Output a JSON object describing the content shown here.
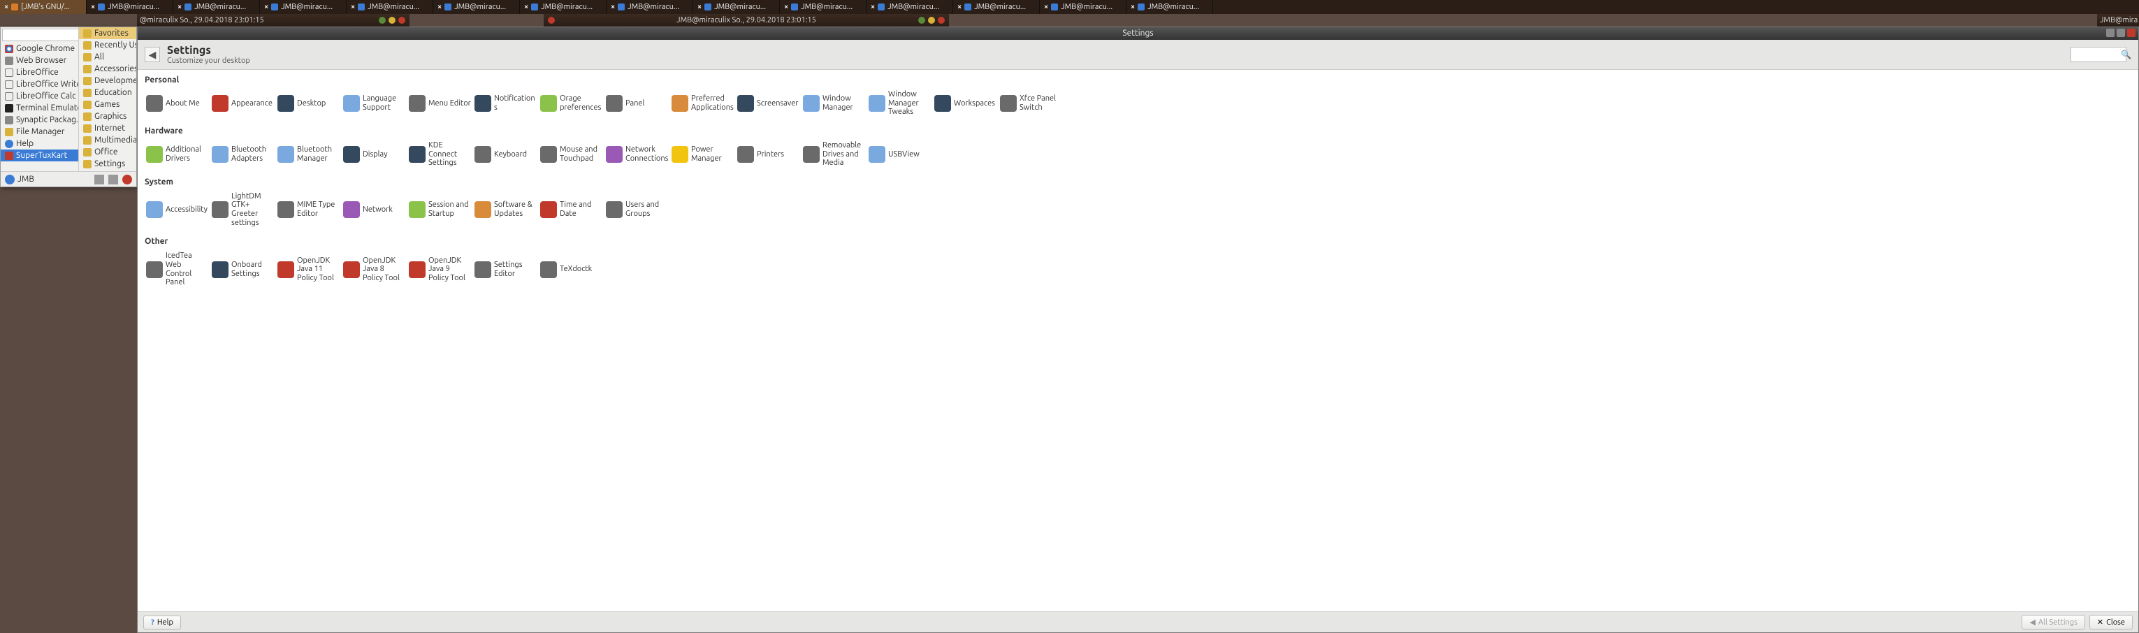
{
  "taskbar": {
    "tasks": [
      {
        "label": "[JMB's GNU/..."
      },
      {
        "label": "JMB@miracu..."
      },
      {
        "label": "JMB@miracu..."
      },
      {
        "label": "JMB@miracu..."
      },
      {
        "label": "JMB@miracu..."
      },
      {
        "label": "JMB@miracu..."
      },
      {
        "label": "JMB@miracu..."
      },
      {
        "label": "JMB@miracu..."
      },
      {
        "label": "JMB@miracu..."
      },
      {
        "label": "JMB@miracu..."
      },
      {
        "label": "JMB@miracu..."
      },
      {
        "label": "JMB@miracu..."
      },
      {
        "label": "JMB@miracu..."
      },
      {
        "label": "JMB@miracu..."
      }
    ]
  },
  "titlebars": {
    "left": "@miraculix  So., 29.04.2018 23:01:15",
    "mid": "JMB@miraculix  So., 29.04.2018 23:01:15",
    "right": "JMB@mira"
  },
  "launcher": {
    "search_placeholder": "",
    "left_items": [
      {
        "label": "Google Chrome",
        "ico": "chrome"
      },
      {
        "label": "Web Browser",
        "ico": "b"
      },
      {
        "label": "LibreOffice",
        "ico": "lib"
      },
      {
        "label": "LibreOffice Writer",
        "ico": "lib"
      },
      {
        "label": "LibreOffice Calc",
        "ico": "lib"
      },
      {
        "label": "Terminal Emulator",
        "ico": "term"
      },
      {
        "label": "Synaptic Packag...",
        "ico": "o"
      },
      {
        "label": "File Manager",
        "ico": "folder"
      },
      {
        "label": "Help",
        "ico": "help"
      },
      {
        "label": "SuperTuxKart",
        "ico": "stk",
        "sel": true
      }
    ],
    "right_items": [
      {
        "label": "Favorites",
        "fav": true
      },
      {
        "label": "Recently Use"
      },
      {
        "label": "All"
      },
      {
        "label": "Accessories"
      },
      {
        "label": "Developmen"
      },
      {
        "label": "Education"
      },
      {
        "label": "Games"
      },
      {
        "label": "Graphics"
      },
      {
        "label": "Internet"
      },
      {
        "label": "Multimedia"
      },
      {
        "label": "Office"
      },
      {
        "label": "Settings"
      }
    ],
    "footer_user": "JMB"
  },
  "settings": {
    "window_title": "Settings",
    "title": "Settings",
    "subtitle": "Customize your desktop",
    "search_placeholder": "",
    "sections": {
      "personal": {
        "h": "Personal",
        "items": [
          {
            "label": "About Me",
            "c": "c3"
          },
          {
            "label": "Appearance",
            "c": "c5"
          },
          {
            "label": "Desktop",
            "c": "c8"
          },
          {
            "label": "Language Support",
            "c": "c1"
          },
          {
            "label": "Menu Editor",
            "c": "c3"
          },
          {
            "label": "Notifications",
            "c": "c8"
          },
          {
            "label": "Orage preferences",
            "c": "c4"
          },
          {
            "label": "Panel",
            "c": "c3"
          },
          {
            "label": "Preferred Applications",
            "c": "c2"
          },
          {
            "label": "Screensaver",
            "c": "c8"
          },
          {
            "label": "Window Manager",
            "c": "c1"
          },
          {
            "label": "Window Manager Tweaks",
            "c": "c1"
          },
          {
            "label": "Workspaces",
            "c": "c8"
          },
          {
            "label": "Xfce Panel Switch",
            "c": "c3"
          }
        ]
      },
      "hardware": {
        "h": "Hardware",
        "items": [
          {
            "label": "Additional Drivers",
            "c": "c4"
          },
          {
            "label": "Bluetooth Adapters",
            "c": "c1"
          },
          {
            "label": "Bluetooth Manager",
            "c": "c1"
          },
          {
            "label": "Display",
            "c": "c8"
          },
          {
            "label": "KDE Connect Settings",
            "c": "c8"
          },
          {
            "label": "Keyboard",
            "c": "c3"
          },
          {
            "label": "Mouse and Touchpad",
            "c": "c3"
          },
          {
            "label": "Network Connections",
            "c": "c6"
          },
          {
            "label": "Power Manager",
            "c": "c7"
          },
          {
            "label": "Printers",
            "c": "c3"
          },
          {
            "label": "Removable Drives and Media",
            "c": "c3"
          },
          {
            "label": "USBView",
            "c": "c1"
          }
        ]
      },
      "system": {
        "h": "System",
        "items": [
          {
            "label": "Accessibility",
            "c": "c1"
          },
          {
            "label": "LightDM GTK+ Greeter settings",
            "c": "c3"
          },
          {
            "label": "MIME Type Editor",
            "c": "c3"
          },
          {
            "label": "Network",
            "c": "c6"
          },
          {
            "label": "Session and Startup",
            "c": "c4"
          },
          {
            "label": "Software & Updates",
            "c": "c2"
          },
          {
            "label": "Time and Date",
            "c": "c5"
          },
          {
            "label": "Users and Groups",
            "c": "c3"
          }
        ]
      },
      "other": {
        "h": "Other",
        "items": [
          {
            "label": "IcedTea Web Control Panel",
            "c": "c3"
          },
          {
            "label": "Onboard Settings",
            "c": "c8"
          },
          {
            "label": "OpenJDK Java 11 Policy Tool",
            "c": "c5"
          },
          {
            "label": "OpenJDK Java 8 Policy Tool",
            "c": "c5"
          },
          {
            "label": "OpenJDK Java 9 Policy Tool",
            "c": "c5"
          },
          {
            "label": "Settings Editor",
            "c": "c3"
          },
          {
            "label": "TeXdoctk",
            "c": "c3"
          }
        ]
      }
    },
    "footer": {
      "help": "Help",
      "all": "All Settings",
      "close": "Close"
    }
  }
}
